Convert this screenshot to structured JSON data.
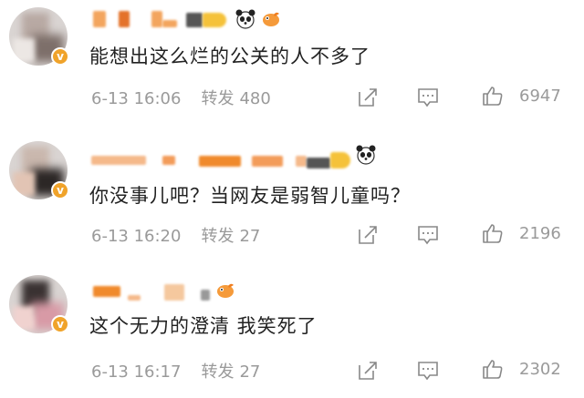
{
  "comments": [
    {
      "text": "能想出这么烂的公关的人不多了",
      "time": "6-13 16:06",
      "repost_label": "转发",
      "repost_count": "480",
      "like_count": "6947",
      "emojis": [
        "panda-icon",
        "goldfish-icon"
      ]
    },
    {
      "text": "你没事儿吧？当网友是弱智儿童吗？",
      "time": "6-13 16:20",
      "repost_label": "转发",
      "repost_count": "27",
      "like_count": "2196",
      "emojis": [
        "panda-icon"
      ]
    },
    {
      "text": "这个无力的澄清  我笑死了",
      "time": "6-13 16:17",
      "repost_label": "转发",
      "repost_count": "27",
      "like_count": "2302",
      "emojis": [
        "goldfish-icon"
      ]
    }
  ],
  "colors": {
    "name_blur": "#f08a2c",
    "verified_badge": "#f0a32a",
    "meta_text": "#9a9a9a",
    "body_text": "#222222"
  }
}
